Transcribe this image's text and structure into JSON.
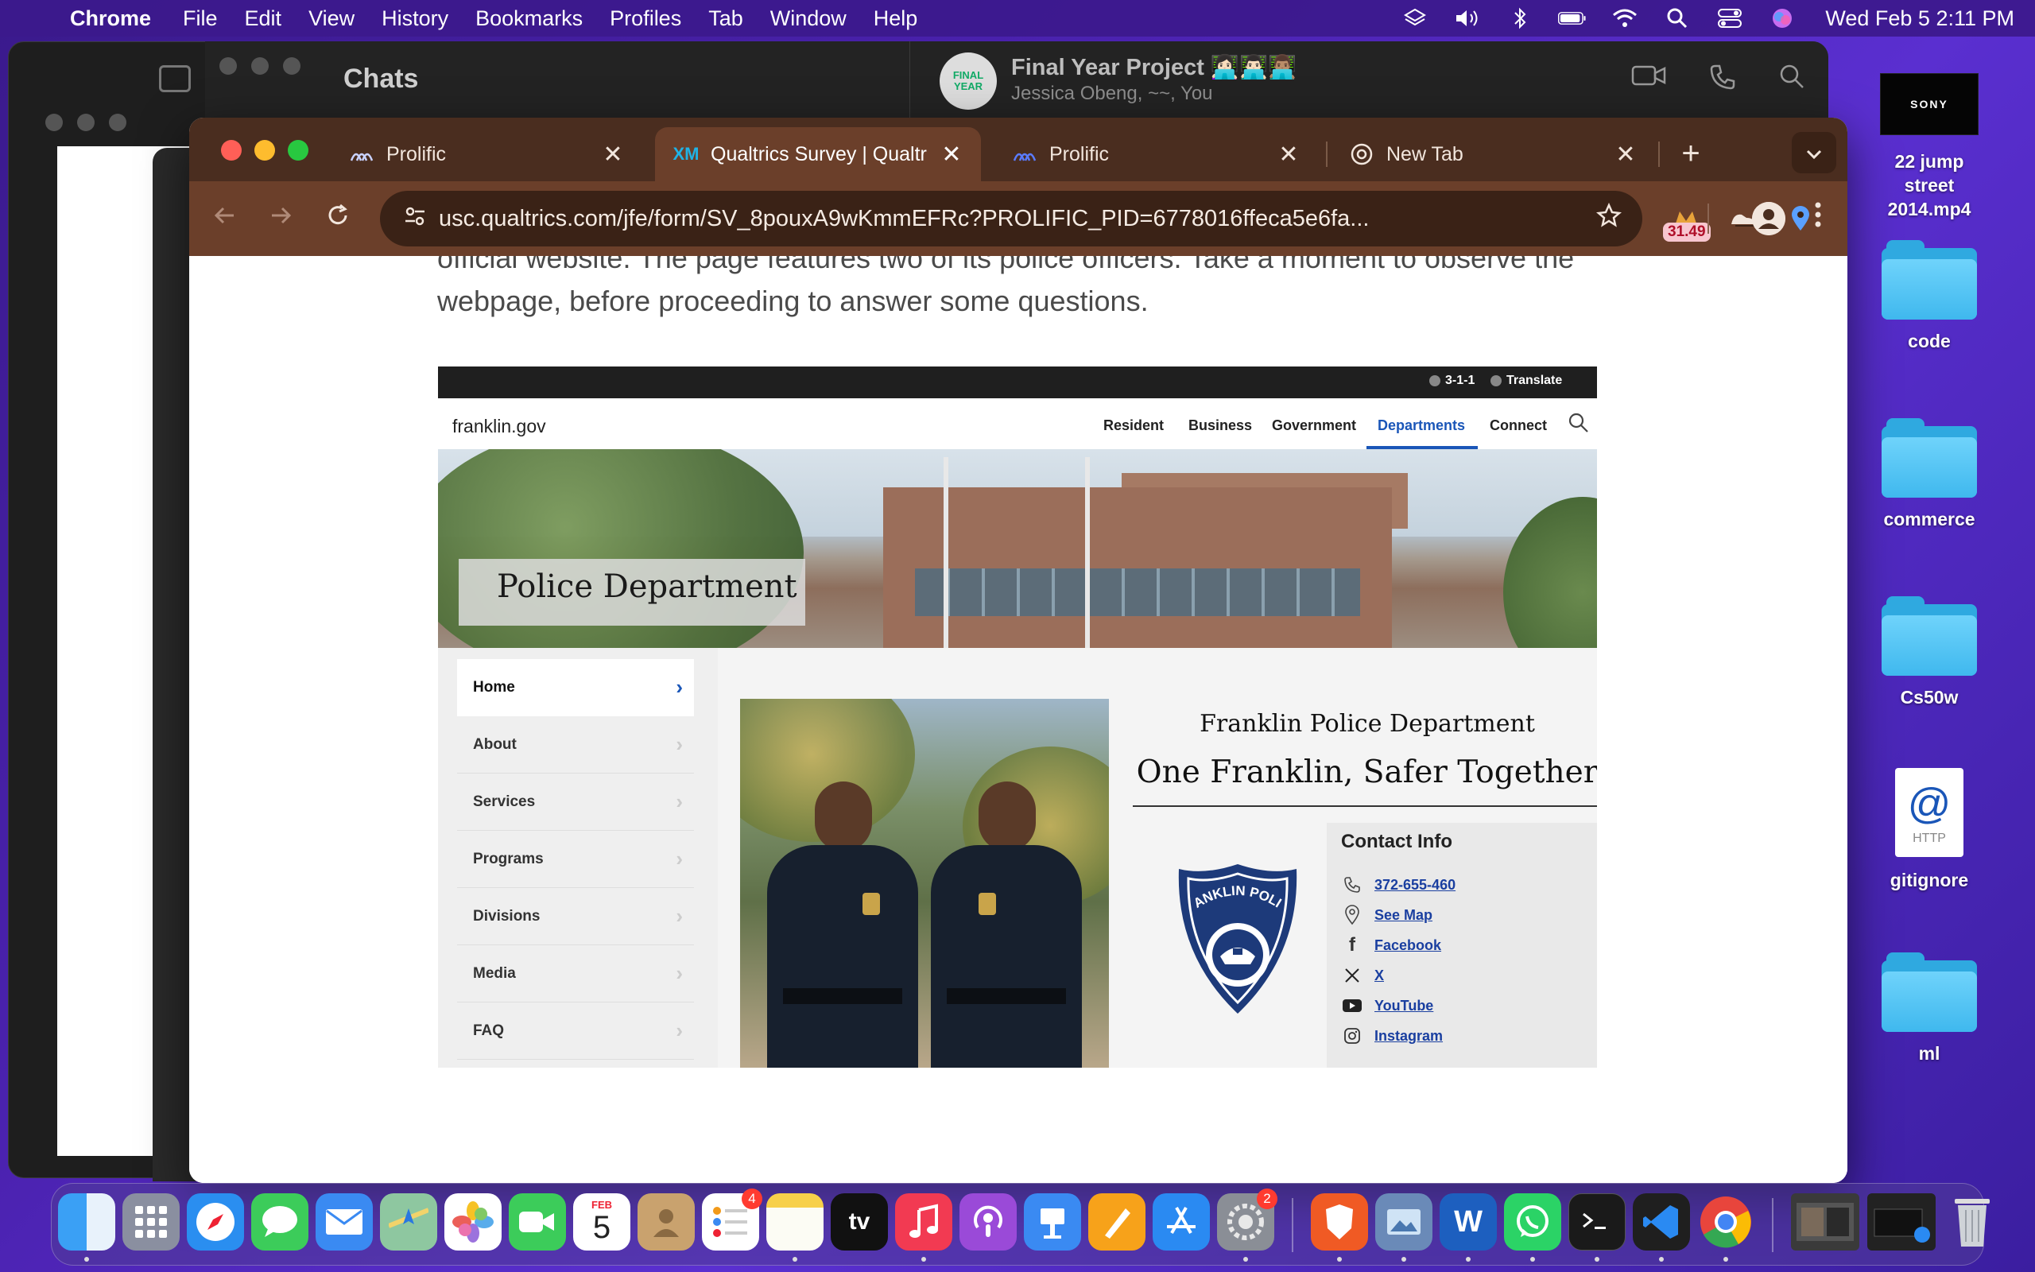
{
  "menubar": {
    "app_name": "Chrome",
    "menus": [
      "File",
      "Edit",
      "View",
      "History",
      "Bookmarks",
      "Profiles",
      "Tab",
      "Window",
      "Help"
    ],
    "clock": "Wed Feb 5  2:11 PM"
  },
  "whatsapp": {
    "title": "Chats",
    "group_name": "Final Year Project 👩🏻‍💻👨🏻‍💻👨🏽‍💻",
    "group_members": "Jessica Obeng, ~~, You",
    "avatar_text": "FINAL YEAR"
  },
  "chrome": {
    "tabs": [
      {
        "label": "Prolific",
        "favicon": "prolific-icon",
        "active": false
      },
      {
        "label": "Qualtrics Survey | Qualtr",
        "favicon": "XM",
        "active": true
      },
      {
        "label": "Prolific",
        "favicon": "prolific-icon",
        "active": false
      },
      {
        "label": "New Tab",
        "favicon": "chrome-icon",
        "active": false
      }
    ],
    "close_glyph": "✕",
    "new_tab_glyph": "+",
    "url": "usc.qualtrics.com/jfe/form/SV_8pouxA9wKmmEFRc?PROLIFIC_PID=6778016ffeca5e6fa...",
    "extension_badge": "31.49"
  },
  "survey": {
    "intro_text": "official website. The page features two of its police officers. Take a moment to observe the webpage, before proceeding to answer some questions."
  },
  "website": {
    "utility_links": [
      "3-1-1",
      "Translate"
    ],
    "logo": "franklin.gov",
    "nav": [
      "Resident",
      "Business",
      "Government",
      "Departments",
      "Connect"
    ],
    "active_nav": "Departments",
    "hero_title": "Police Department",
    "sidebar": [
      "Home",
      "About",
      "Services",
      "Programs",
      "Divisions",
      "Media",
      "FAQ"
    ],
    "department_name": "Franklin Police Department",
    "slogan": "One Franklin, Safer Together",
    "shield_text": "FRANKLIN POLICE",
    "contact": {
      "title": "Contact Info",
      "items": [
        {
          "icon": "phone-icon",
          "label": "372-655-460"
        },
        {
          "icon": "map-pin-icon",
          "label": "See Map"
        },
        {
          "icon": "facebook-icon",
          "label": "Facebook"
        },
        {
          "icon": "x-icon",
          "label": "X"
        },
        {
          "icon": "youtube-icon",
          "label": "YouTube"
        },
        {
          "icon": "instagram-icon",
          "label": "Instagram"
        }
      ]
    }
  },
  "desktop": {
    "items": [
      {
        "label": "22 jump street 2014.mp4",
        "type": "video",
        "thumb_text": "SONY"
      },
      {
        "label": "code",
        "type": "folder"
      },
      {
        "label": "commerce",
        "type": "folder"
      },
      {
        "label": "Cs50w",
        "type": "folder"
      },
      {
        "label": "gitignore",
        "type": "file",
        "icon_text": "@",
        "sub_text": "HTTP"
      },
      {
        "label": "ml",
        "type": "folder"
      }
    ]
  },
  "dock": {
    "calendar_month": "FEB",
    "calendar_day": "5",
    "reminders_badge": "4",
    "settings_badge": "2",
    "tv_label": "tv"
  }
}
